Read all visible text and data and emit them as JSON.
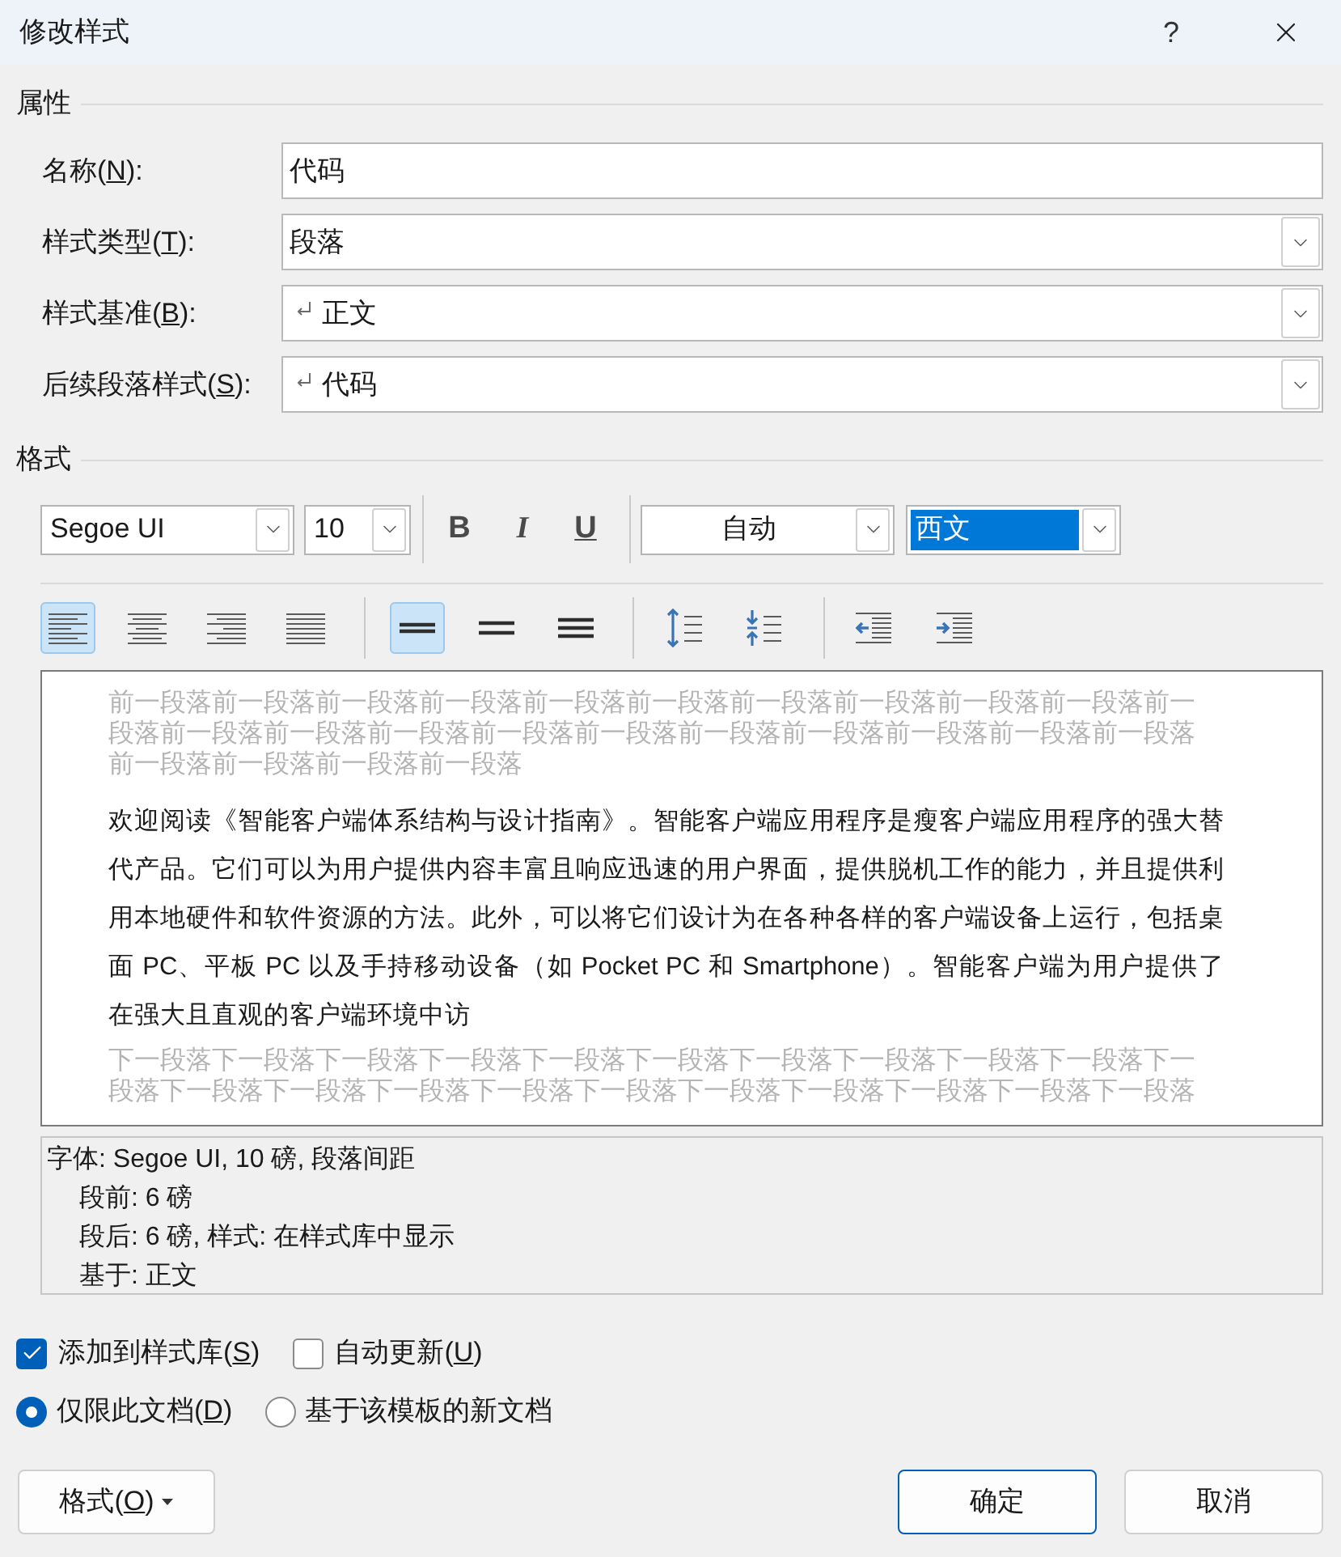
{
  "window": {
    "title": "修改样式",
    "help": "?"
  },
  "properties": {
    "heading": "属性",
    "fields": [
      {
        "kind": "text",
        "label": "名称(",
        "key": "N",
        "label_end": "):",
        "value": "代码"
      },
      {
        "kind": "select",
        "label": "样式类型(",
        "key": "T",
        "label_end": "):",
        "value": "段落"
      },
      {
        "kind": "style-select",
        "label": "样式基准(",
        "key": "B",
        "label_end": "):",
        "value": "正文"
      },
      {
        "kind": "style-select",
        "label": "后续段落样式(",
        "key": "S",
        "label_end": "):",
        "value": "代码"
      }
    ]
  },
  "format": {
    "heading": "格式",
    "font": {
      "value": "Segoe UI",
      "focused": false
    },
    "size": {
      "value": "10",
      "focused": false
    },
    "styles": [
      {
        "kind": "bold",
        "label": "B"
      },
      {
        "kind": "italic",
        "label": "I"
      },
      {
        "kind": "underline",
        "label": "U"
      }
    ],
    "color": {
      "value": "自动",
      "focused": false
    },
    "script": {
      "value": "西文",
      "focused": true
    },
    "alignment": [
      {
        "kind": "left",
        "selected": true
      },
      {
        "kind": "center",
        "selected": false
      },
      {
        "kind": "right",
        "selected": false
      },
      {
        "kind": "justify",
        "selected": false
      }
    ],
    "line_spacing": [
      {
        "kind": "single",
        "selected": true
      },
      {
        "kind": "one-half",
        "selected": false
      },
      {
        "kind": "double",
        "selected": false
      }
    ],
    "paragraph_spacing": [
      {
        "kind": "increase"
      },
      {
        "kind": "decrease"
      }
    ],
    "indent": [
      {
        "kind": "decrease"
      },
      {
        "kind": "increase"
      }
    ]
  },
  "preview": {
    "previous": "前一段落前一段落前一段落前一段落前一段落前一段落前一段落前一段落前一段落前一段落前一段落前一段落前一段落前一段落前一段落前一段落前一段落前一段落前一段落前一段落前一段落前一段落前一段落前一段落前一段落",
    "text": "欢迎阅读《智能客户端体系结构与设计指南》。智能客户端应用程序是瘦客户端应用程序的强大替代产品。它们可以为用户提供内容丰富且响应迅速的用户界面，提供脱机工作的能力，并且提供利用本地硬件和软件资源的方法。此外，可以将它们设计为在各种各样的客户端设备上运行，包括桌面 PC、平板 PC 以及手持移动设备（如 Pocket PC 和 Smartphone）。智能客户端为用户提供了在强大且直观的客户端环境中访",
    "next": "下一段落下一段落下一段落下一段落下一段落下一段落下一段落下一段落下一段落下一段落下一段落下一段落下一段落下一段落下一段落下一段落下一段落下一段落下一段落下一段落下一段落"
  },
  "description": [
    {
      "text": "字体: Segoe UI, 10 磅, 段落间距",
      "children": [
        {
          "text": "段前: 6 磅"
        },
        {
          "text": "段后: 6 磅, 样式: 在样式库中显示"
        },
        {
          "text": "基于: 正文"
        }
      ]
    }
  ],
  "checkboxes": [
    {
      "label": "添加到样式库(",
      "key": "S",
      "label_end": ")",
      "checked": true
    },
    {
      "label": "自动更新(",
      "key": "U",
      "label_end": ")",
      "checked": false
    }
  ],
  "radios": [
    {
      "label": "仅限此文档(",
      "key": "D",
      "label_end": ")",
      "selected": true
    },
    {
      "label": "基于该模板的新文档",
      "selected": false
    }
  ],
  "buttons": [
    {
      "kind": "menu",
      "label": "格式(",
      "key": "O",
      "label_end": ")",
      "default": false
    },
    {
      "kind": "push",
      "label": "确定",
      "default": true
    },
    {
      "kind": "push",
      "label": "取消",
      "default": false
    }
  ]
}
